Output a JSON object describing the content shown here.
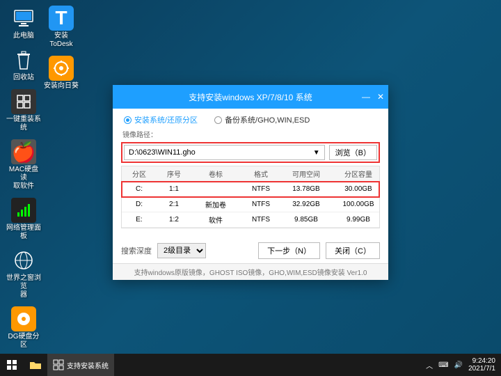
{
  "desktop_icons_col1": [
    {
      "id": "this-pc",
      "label": "此电脑"
    },
    {
      "id": "recycle",
      "label": "回收站"
    },
    {
      "id": "reinstall",
      "label": "一键重装系统"
    },
    {
      "id": "mac",
      "label": "MAC硬盘读\n取软件"
    },
    {
      "id": "network",
      "label": "网络管理面板"
    },
    {
      "id": "world",
      "label": "世界之窗浏览\n器"
    },
    {
      "id": "dg",
      "label": "DG硬盘分区"
    }
  ],
  "desktop_icons_col2": [
    {
      "id": "todesk",
      "label": "安装ToDesk"
    },
    {
      "id": "sunflower",
      "label": "安装向日葵"
    }
  ],
  "installer": {
    "title": "支持安装windows XP/7/8/10 系统",
    "tab_install": "安装系统/还原分区",
    "tab_backup": "备份系统/GHO,WIN,ESD",
    "path_label": "镜像路径：",
    "path_value": "D:\\0623\\WIN11.gho",
    "browse": "浏览（B）",
    "columns": [
      "分区",
      "序号",
      "卷标",
      "格式",
      "可用空间",
      "分区容量"
    ],
    "rows": [
      {
        "p": "C:",
        "n": "1:1",
        "v": "",
        "f": "NTFS",
        "a": "13.78GB",
        "s": "30.00GB",
        "hl": true
      },
      {
        "p": "D:",
        "n": "2:1",
        "v": "新加卷",
        "f": "NTFS",
        "a": "32.92GB",
        "s": "100.00GB"
      },
      {
        "p": "E:",
        "n": "1:2",
        "v": "软件",
        "f": "NTFS",
        "a": "9.85GB",
        "s": "9.99GB"
      }
    ],
    "search_depth_label": "搜索深度",
    "search_depth_value": "2级目录",
    "next": "下一步（N）",
    "close": "关闭（C）",
    "status": "支持windows原版镜像，GHOST ISO镜像，GHO,WIM,ESD镜像安装 Ver1.0"
  },
  "taskbar": {
    "app": "支持安装系统",
    "time": "9:24:20",
    "date": "2021/7/1"
  }
}
